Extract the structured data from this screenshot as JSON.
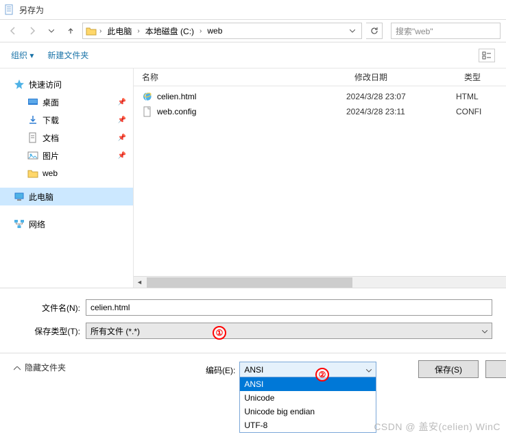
{
  "window_title": "另存为",
  "breadcrumbs": [
    "此电脑",
    "本地磁盘 (C:)",
    "web"
  ],
  "search_placeholder": "搜索\"web\"",
  "toolbar": {
    "organize": "组织 ▾",
    "new_folder": "新建文件夹"
  },
  "columns": {
    "name": "名称",
    "date": "修改日期",
    "type": "类型"
  },
  "sidebar": {
    "quick_access": "快速访问",
    "desktop": "桌面",
    "downloads": "下载",
    "documents": "文档",
    "pictures": "图片",
    "web": "web",
    "this_pc": "此电脑",
    "network": "网络"
  },
  "files": [
    {
      "name": "celien.html",
      "date": "2024/3/28 23:07",
      "type": "HTML",
      "icon": "ie"
    },
    {
      "name": "web.config",
      "date": "2024/3/28 23:11",
      "type": "CONFI",
      "icon": "config"
    }
  ],
  "form": {
    "filename_label": "文件名(N):",
    "filename_value": "celien.html",
    "savetype_label": "保存类型(T):",
    "savetype_value": "所有文件 (*.*)"
  },
  "bottom": {
    "hide_folders": "隐藏文件夹",
    "encoding_label": "编码(E):",
    "encoding_selected": "ANSI",
    "encoding_options": [
      "ANSI",
      "Unicode",
      "Unicode big endian",
      "UTF-8"
    ],
    "save_button": "保存(S)"
  },
  "annotations": {
    "a1": "①",
    "a2": "②"
  },
  "watermark": "CSDN @ 盖安(celien) WinC"
}
